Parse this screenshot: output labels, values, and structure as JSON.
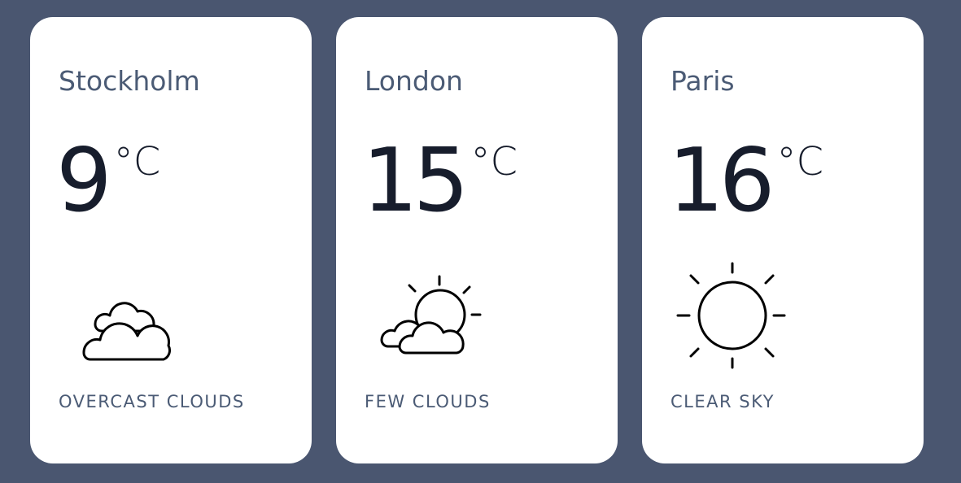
{
  "cards": [
    {
      "city": "Stockholm",
      "temperature": "9",
      "unit": "°C",
      "description": "OVERCAST CLOUDS",
      "icon": "overcast-clouds-icon"
    },
    {
      "city": "London",
      "temperature": "15",
      "unit": "°C",
      "description": "FEW CLOUDS",
      "icon": "few-clouds-icon"
    },
    {
      "city": "Paris",
      "temperature": "16",
      "unit": "°C",
      "description": "CLEAR SKY",
      "icon": "clear-sky-icon"
    }
  ],
  "colors": {
    "background": "#4a5670",
    "card": "#ffffff",
    "city_text": "#4b5b75",
    "temperature_text": "#171d2c",
    "icon_stroke": "#000000"
  }
}
